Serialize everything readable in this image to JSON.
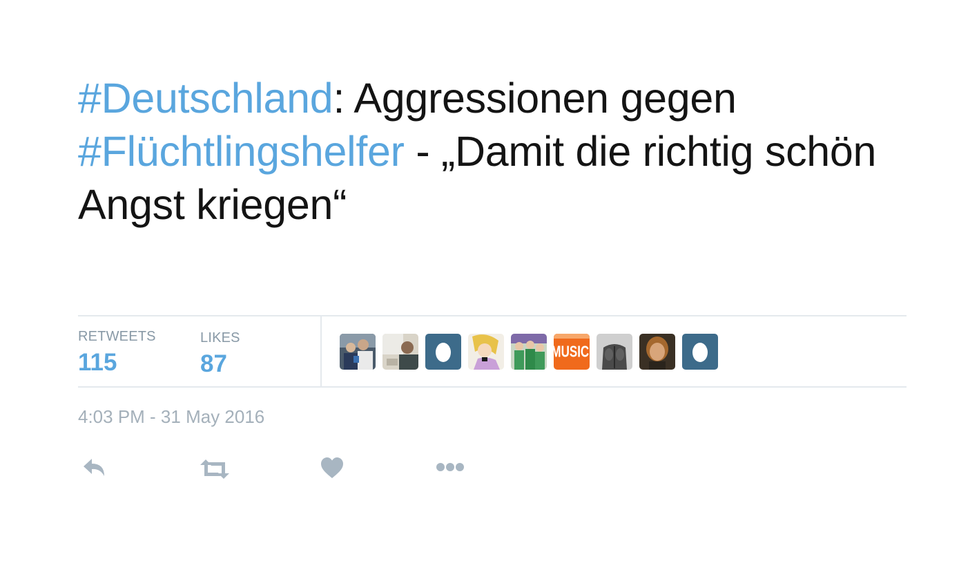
{
  "tweet": {
    "segments": [
      {
        "text": "#Deutschland",
        "hashtag": true
      },
      {
        "text": ": Aggressionen gegen ",
        "hashtag": false
      },
      {
        "text": "#Flüchtlingshelfer",
        "hashtag": true
      },
      {
        "text": " - „Damit die richtig schön Angst kriegen“",
        "hashtag": false
      }
    ]
  },
  "stats": {
    "retweets_label": "RETWEETS",
    "retweets_count": "115",
    "likes_label": "LIKES",
    "likes_count": "87"
  },
  "avatars": [
    {
      "name": "avatar-photo-group",
      "kind": "photo"
    },
    {
      "name": "avatar-photo-person",
      "kind": "photo"
    },
    {
      "name": "avatar-default-egg",
      "kind": "egg"
    },
    {
      "name": "avatar-cartoon-princess",
      "kind": "cartoon"
    },
    {
      "name": "avatar-green-figures",
      "kind": "photo"
    },
    {
      "name": "avatar-music",
      "kind": "music",
      "text": "MUSIC"
    },
    {
      "name": "avatar-photo-back",
      "kind": "photo"
    },
    {
      "name": "avatar-photo-man",
      "kind": "photo"
    },
    {
      "name": "avatar-default-egg",
      "kind": "egg"
    }
  ],
  "timestamp": "4:03 PM - 31 May 2016",
  "actions": [
    {
      "name": "reply-icon"
    },
    {
      "name": "retweet-icon"
    },
    {
      "name": "like-icon"
    },
    {
      "name": "more-icon"
    }
  ],
  "colors": {
    "hashtag": "#5aa6de",
    "text": "#141414",
    "muted": "#a4b0ba",
    "icon": "#a8b6c2",
    "egg_bg": "#3d6b8a",
    "music_bg": "#f06a1c"
  }
}
